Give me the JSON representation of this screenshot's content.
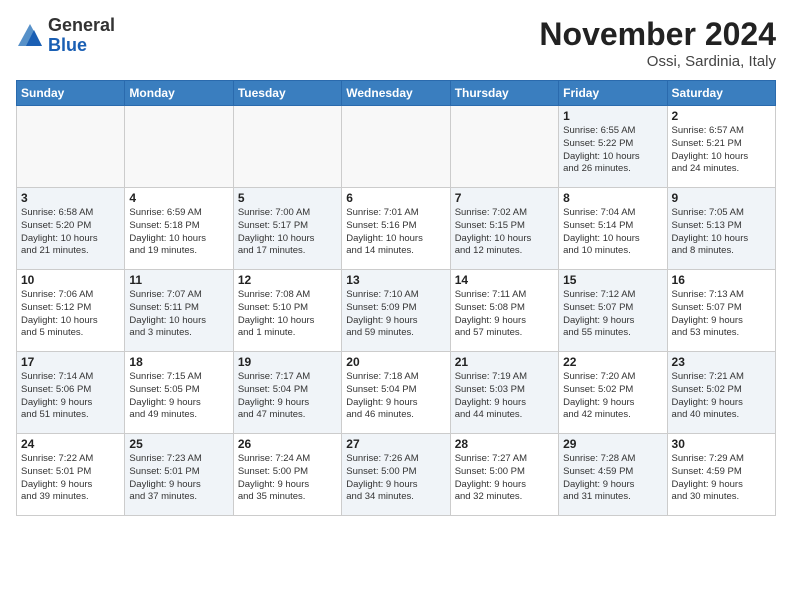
{
  "header": {
    "logo_general": "General",
    "logo_blue": "Blue",
    "month_title": "November 2024",
    "location": "Ossi, Sardinia, Italy"
  },
  "days_of_week": [
    "Sunday",
    "Monday",
    "Tuesday",
    "Wednesday",
    "Thursday",
    "Friday",
    "Saturday"
  ],
  "weeks": [
    [
      {
        "day": "",
        "info": "",
        "empty": true
      },
      {
        "day": "",
        "info": "",
        "empty": true
      },
      {
        "day": "",
        "info": "",
        "empty": true
      },
      {
        "day": "",
        "info": "",
        "empty": true
      },
      {
        "day": "",
        "info": "",
        "empty": true
      },
      {
        "day": "1",
        "info": "Sunrise: 6:55 AM\nSunset: 5:22 PM\nDaylight: 10 hours\nand 26 minutes.",
        "shaded": true
      },
      {
        "day": "2",
        "info": "Sunrise: 6:57 AM\nSunset: 5:21 PM\nDaylight: 10 hours\nand 24 minutes.",
        "shaded": false
      }
    ],
    [
      {
        "day": "3",
        "info": "Sunrise: 6:58 AM\nSunset: 5:20 PM\nDaylight: 10 hours\nand 21 minutes.",
        "shaded": true
      },
      {
        "day": "4",
        "info": "Sunrise: 6:59 AM\nSunset: 5:18 PM\nDaylight: 10 hours\nand 19 minutes.",
        "shaded": false
      },
      {
        "day": "5",
        "info": "Sunrise: 7:00 AM\nSunset: 5:17 PM\nDaylight: 10 hours\nand 17 minutes.",
        "shaded": true
      },
      {
        "day": "6",
        "info": "Sunrise: 7:01 AM\nSunset: 5:16 PM\nDaylight: 10 hours\nand 14 minutes.",
        "shaded": false
      },
      {
        "day": "7",
        "info": "Sunrise: 7:02 AM\nSunset: 5:15 PM\nDaylight: 10 hours\nand 12 minutes.",
        "shaded": true
      },
      {
        "day": "8",
        "info": "Sunrise: 7:04 AM\nSunset: 5:14 PM\nDaylight: 10 hours\nand 10 minutes.",
        "shaded": false
      },
      {
        "day": "9",
        "info": "Sunrise: 7:05 AM\nSunset: 5:13 PM\nDaylight: 10 hours\nand 8 minutes.",
        "shaded": true
      }
    ],
    [
      {
        "day": "10",
        "info": "Sunrise: 7:06 AM\nSunset: 5:12 PM\nDaylight: 10 hours\nand 5 minutes.",
        "shaded": false
      },
      {
        "day": "11",
        "info": "Sunrise: 7:07 AM\nSunset: 5:11 PM\nDaylight: 10 hours\nand 3 minutes.",
        "shaded": true
      },
      {
        "day": "12",
        "info": "Sunrise: 7:08 AM\nSunset: 5:10 PM\nDaylight: 10 hours\nand 1 minute.",
        "shaded": false
      },
      {
        "day": "13",
        "info": "Sunrise: 7:10 AM\nSunset: 5:09 PM\nDaylight: 9 hours\nand 59 minutes.",
        "shaded": true
      },
      {
        "day": "14",
        "info": "Sunrise: 7:11 AM\nSunset: 5:08 PM\nDaylight: 9 hours\nand 57 minutes.",
        "shaded": false
      },
      {
        "day": "15",
        "info": "Sunrise: 7:12 AM\nSunset: 5:07 PM\nDaylight: 9 hours\nand 55 minutes.",
        "shaded": true
      },
      {
        "day": "16",
        "info": "Sunrise: 7:13 AM\nSunset: 5:07 PM\nDaylight: 9 hours\nand 53 minutes.",
        "shaded": false
      }
    ],
    [
      {
        "day": "17",
        "info": "Sunrise: 7:14 AM\nSunset: 5:06 PM\nDaylight: 9 hours\nand 51 minutes.",
        "shaded": true
      },
      {
        "day": "18",
        "info": "Sunrise: 7:15 AM\nSunset: 5:05 PM\nDaylight: 9 hours\nand 49 minutes.",
        "shaded": false
      },
      {
        "day": "19",
        "info": "Sunrise: 7:17 AM\nSunset: 5:04 PM\nDaylight: 9 hours\nand 47 minutes.",
        "shaded": true
      },
      {
        "day": "20",
        "info": "Sunrise: 7:18 AM\nSunset: 5:04 PM\nDaylight: 9 hours\nand 46 minutes.",
        "shaded": false
      },
      {
        "day": "21",
        "info": "Sunrise: 7:19 AM\nSunset: 5:03 PM\nDaylight: 9 hours\nand 44 minutes.",
        "shaded": true
      },
      {
        "day": "22",
        "info": "Sunrise: 7:20 AM\nSunset: 5:02 PM\nDaylight: 9 hours\nand 42 minutes.",
        "shaded": false
      },
      {
        "day": "23",
        "info": "Sunrise: 7:21 AM\nSunset: 5:02 PM\nDaylight: 9 hours\nand 40 minutes.",
        "shaded": true
      }
    ],
    [
      {
        "day": "24",
        "info": "Sunrise: 7:22 AM\nSunset: 5:01 PM\nDaylight: 9 hours\nand 39 minutes.",
        "shaded": false
      },
      {
        "day": "25",
        "info": "Sunrise: 7:23 AM\nSunset: 5:01 PM\nDaylight: 9 hours\nand 37 minutes.",
        "shaded": true
      },
      {
        "day": "26",
        "info": "Sunrise: 7:24 AM\nSunset: 5:00 PM\nDaylight: 9 hours\nand 35 minutes.",
        "shaded": false
      },
      {
        "day": "27",
        "info": "Sunrise: 7:26 AM\nSunset: 5:00 PM\nDaylight: 9 hours\nand 34 minutes.",
        "shaded": true
      },
      {
        "day": "28",
        "info": "Sunrise: 7:27 AM\nSunset: 5:00 PM\nDaylight: 9 hours\nand 32 minutes.",
        "shaded": false
      },
      {
        "day": "29",
        "info": "Sunrise: 7:28 AM\nSunset: 4:59 PM\nDaylight: 9 hours\nand 31 minutes.",
        "shaded": true
      },
      {
        "day": "30",
        "info": "Sunrise: 7:29 AM\nSunset: 4:59 PM\nDaylight: 9 hours\nand 30 minutes.",
        "shaded": false
      }
    ]
  ]
}
